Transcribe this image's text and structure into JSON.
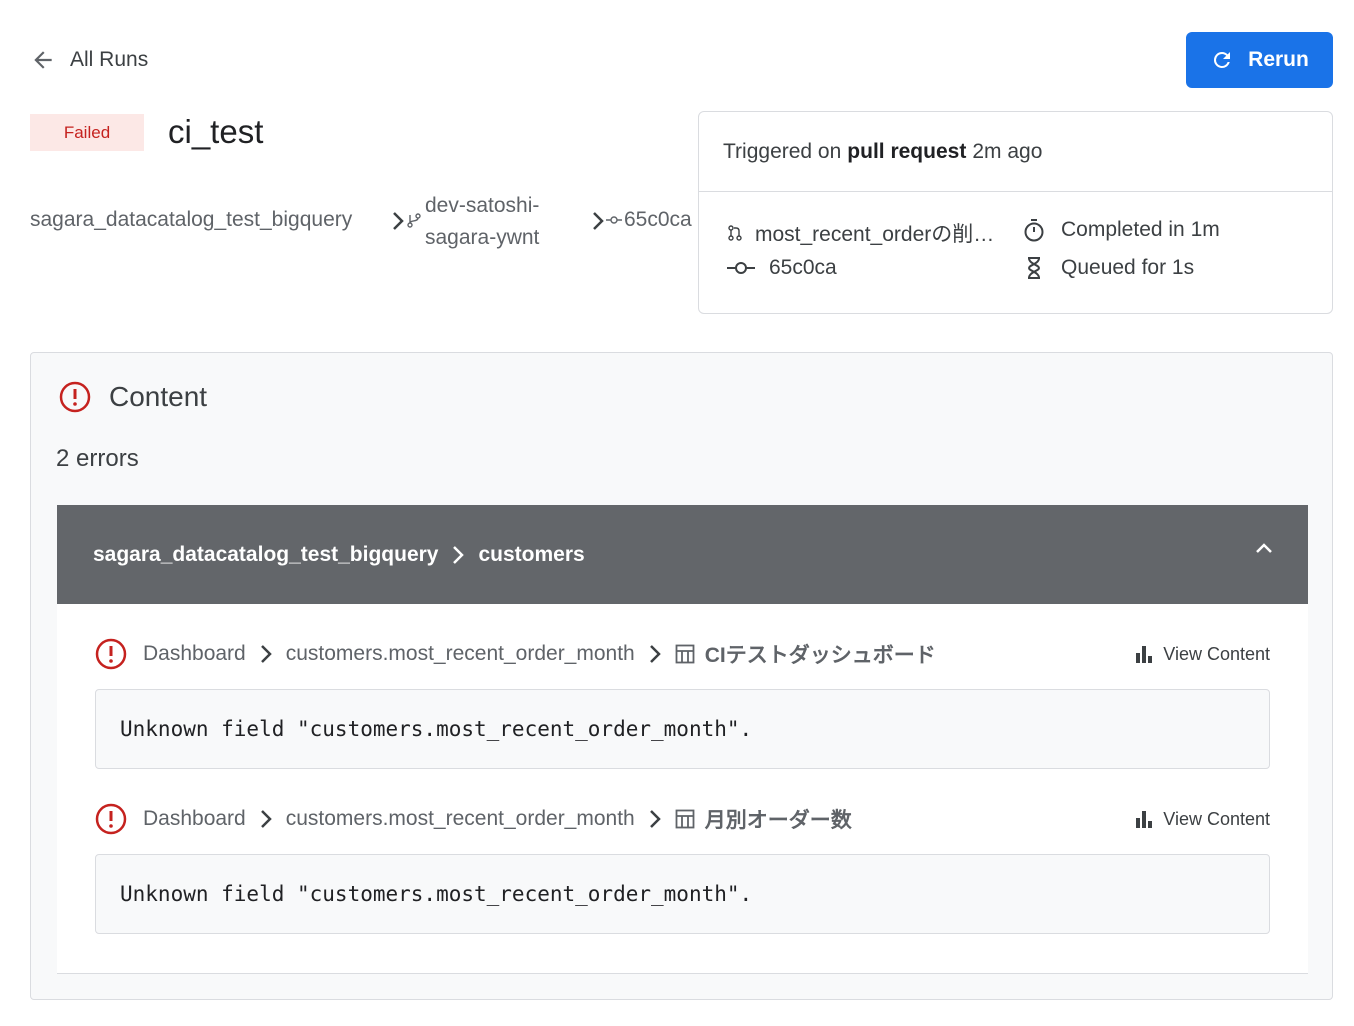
{
  "nav": {
    "back_label": "All Runs"
  },
  "toolbar": {
    "rerun_label": "Rerun"
  },
  "run": {
    "status": "Failed",
    "title": "ci_test",
    "breadcrumb": {
      "project": "sagara_datacatalog_test_bigquery",
      "branch": "dev-satoshi-sagara-ywnt",
      "commit": "65c0ca"
    }
  },
  "trigger": {
    "prefix": "Triggered on",
    "event": "pull request",
    "when": "2m ago",
    "pr_title": "most_recent_orderの削…",
    "commit": "65c0ca",
    "completed": "Completed in 1m",
    "queued": "Queued for 1s"
  },
  "content": {
    "title": "Content",
    "error_count": "2 errors",
    "group": {
      "project": "sagara_datacatalog_test_bigquery",
      "model": "customers"
    },
    "errors": [
      {
        "type": "Dashboard",
        "field": "customers.most_recent_order_month",
        "dashboard": "CIテストダッシュボード",
        "action": "View Content",
        "message": "Unknown field \"customers.most_recent_order_month\"."
      },
      {
        "type": "Dashboard",
        "field": "customers.most_recent_order_month",
        "dashboard": "月別オーダー数",
        "action": "View Content",
        "message": "Unknown field \"customers.most_recent_order_month\"."
      }
    ]
  },
  "colors": {
    "primary": "#1a73e8",
    "error": "#c5221f",
    "failed_bg": "#fce8e6",
    "group_header": "#63666a"
  }
}
